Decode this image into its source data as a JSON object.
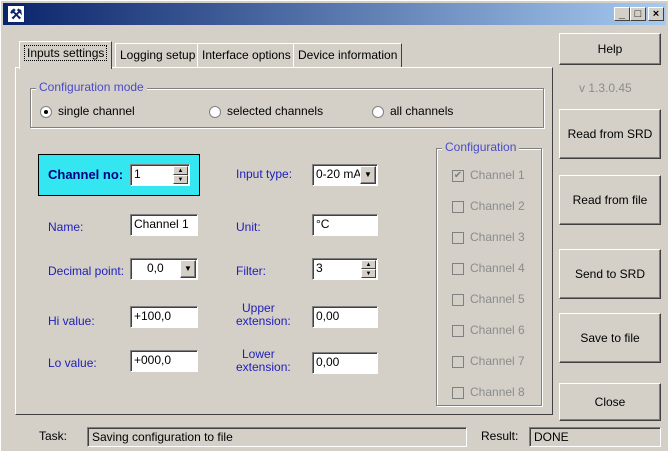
{
  "window": {
    "app_icon": "satellite-dish-icon",
    "minimize_glyph": "_",
    "maximize_glyph": "□",
    "close_glyph": "×"
  },
  "tabs": [
    {
      "label": "Inputs settings",
      "active": true
    },
    {
      "label": "Logging setup",
      "active": false
    },
    {
      "label": "Interface options",
      "active": false
    },
    {
      "label": "Device information",
      "active": false
    }
  ],
  "config_mode": {
    "title": "Configuration mode",
    "options": [
      "single channel",
      "selected channels",
      "all channels"
    ],
    "selected": "single channel"
  },
  "fields": {
    "channel_no_label": "Channel no:",
    "channel_no_value": "1",
    "name_label": "Name:",
    "name_value": "Channel 1",
    "decimal_point_label": "Decimal point:",
    "decimal_point_value": "0,0",
    "hi_value_label": "Hi value:",
    "hi_value_value": "+100,0",
    "lo_value_label": "Lo value:",
    "lo_value_value": "+000,0",
    "input_type_label": "Input type:",
    "input_type_value": "0-20 mA",
    "unit_label": "Unit:",
    "unit_value": "°C",
    "filter_label": "Filter:",
    "filter_value": "3",
    "upper_extension_label_1": "Upper",
    "upper_extension_label_2": "extension:",
    "upper_extension_value": "0,00",
    "lower_extension_label_1": "Lower",
    "lower_extension_label_2": "extension:",
    "lower_extension_value": "0,00"
  },
  "configuration": {
    "title": "Configuration",
    "channels": [
      {
        "label": "Channel 1",
        "checked": true
      },
      {
        "label": "Channel 2",
        "checked": false
      },
      {
        "label": "Channel 3",
        "checked": false
      },
      {
        "label": "Channel 4",
        "checked": false
      },
      {
        "label": "Channel 5",
        "checked": false
      },
      {
        "label": "Channel 6",
        "checked": false
      },
      {
        "label": "Channel 7",
        "checked": false
      },
      {
        "label": "Channel 8",
        "checked": false
      }
    ]
  },
  "side": {
    "help_label": "Help",
    "version": "v 1.3.0.45",
    "read_from_srd_label": "Read from SRD",
    "read_from_file_label": "Read from file",
    "send_to_srd_label": "Send to SRD",
    "save_to_file_label": "Save to file",
    "close_label": "Close"
  },
  "status": {
    "task_label": "Task:",
    "task_value": "Saving configuration to file",
    "result_label": "Result:",
    "result_value": "DONE"
  },
  "colors": {
    "titlebar_start": "#0a246a",
    "titlebar_end": "#a6caf0",
    "highlight": "#33e6f0",
    "label_blue": "#2020b8"
  }
}
